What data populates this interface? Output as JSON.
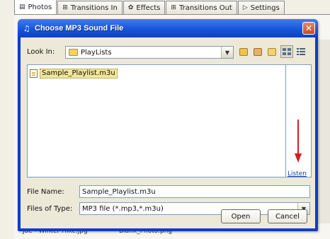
{
  "background_app": {
    "tabs": [
      {
        "label": "Photos",
        "icon": "photos-icon"
      },
      {
        "label": "Transitions In",
        "icon": "transitions-in-icon"
      },
      {
        "label": "Effects",
        "icon": "effects-icon"
      },
      {
        "label": "Transitions Out",
        "icon": "transitions-out-icon"
      },
      {
        "label": "Settings",
        "icon": "settings-icon"
      }
    ],
    "files": [
      "Joe - Winter Hike.jpg",
      "Blank_Photo.png"
    ]
  },
  "dialog": {
    "title": "Choose MP3 Sound File",
    "look_in_label": "Look In:",
    "look_in_value": "PlayLists",
    "files": [
      {
        "name": "Sample_Playlist.m3u",
        "selected": true
      }
    ],
    "listen_link": "Listen",
    "file_name_label": "File Name:",
    "file_name_value": "Sample_Playlist.m3u",
    "files_of_type_label": "Files of Type:",
    "files_of_type_value": "MP3 file (*.mp3,*.m3u)",
    "open_button": "Open",
    "cancel_button": "Cancel",
    "close_glyph": "✕"
  },
  "colors": {
    "titlebar": "#1652d6",
    "accent_arrow": "#d21f1f",
    "link": "#1740b8",
    "selection": "#f3e59a"
  }
}
